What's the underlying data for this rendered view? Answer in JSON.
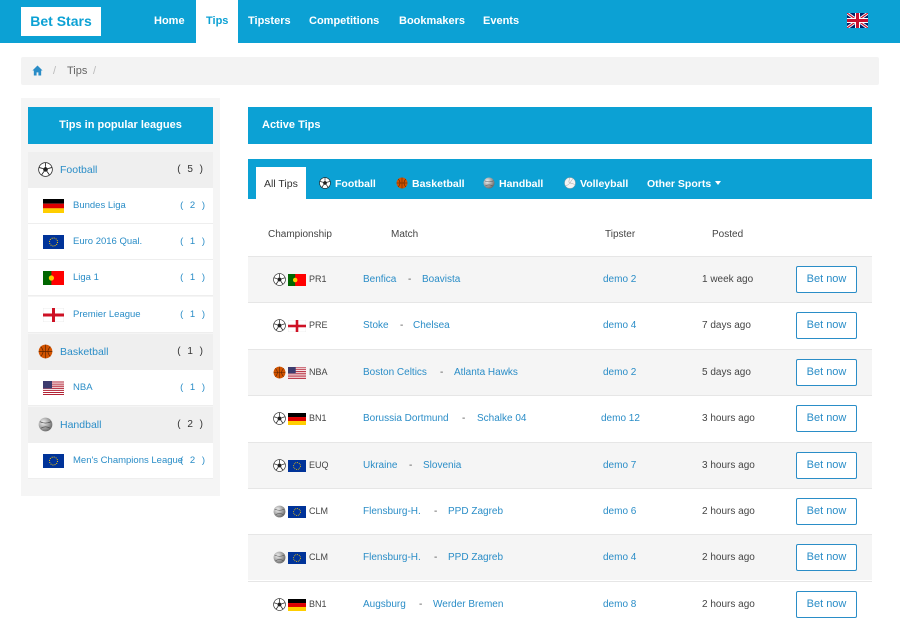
{
  "brand": "Bet Stars",
  "nav": [
    "Home",
    "Tips",
    "Tipsters",
    "Competitions",
    "Bookmakers",
    "Events"
  ],
  "breadcrumb": {
    "current": "Tips"
  },
  "sidebar": {
    "title": "Tips in popular leagues",
    "sports": [
      {
        "label": "Football",
        "count": "( 5 )",
        "icon": "football-icon",
        "leagues": [
          {
            "label": "Bundes Liga",
            "count": "( 2 )",
            "flag": "de"
          },
          {
            "label": "Euro 2016 Qual.",
            "count": "( 1 )",
            "flag": "eu"
          },
          {
            "label": "Liga 1",
            "count": "( 1 )",
            "flag": "pt"
          },
          {
            "label": "Premier League",
            "count": "( 1 )",
            "flag": "en"
          }
        ]
      },
      {
        "label": "Basketball",
        "count": "( 1 )",
        "icon": "basketball-icon",
        "leagues": [
          {
            "label": "NBA",
            "count": "( 1 )",
            "flag": "us"
          }
        ]
      },
      {
        "label": "Handball",
        "count": "( 2 )",
        "icon": "handball-icon",
        "leagues": [
          {
            "label": "Men's Champions League",
            "count": "( 2 )",
            "flag": "eu"
          }
        ]
      }
    ]
  },
  "main": {
    "title": "Active Tips",
    "tabs": [
      {
        "label": "All Tips",
        "icon": ""
      },
      {
        "label": "Football",
        "icon": "football-icon"
      },
      {
        "label": "Basketball",
        "icon": "basketball-icon"
      },
      {
        "label": "Handball",
        "icon": "handball-icon"
      },
      {
        "label": "Volleyball",
        "icon": "volleyball-icon"
      },
      {
        "label": "Other Sports",
        "icon": ""
      }
    ],
    "columns": [
      "Championship",
      "Match",
      "Tipster",
      "Posted"
    ],
    "bet_label": "Bet now",
    "rows": [
      {
        "sport": "football",
        "flag": "pt",
        "code": "PR1",
        "home": "Benfica",
        "away": "Boavista",
        "tipster": "demo 2",
        "posted": "1 week ago"
      },
      {
        "sport": "football",
        "flag": "en",
        "code": "PRE",
        "home": "Stoke",
        "away": "Chelsea",
        "tipster": "demo 4",
        "posted": "7 days ago"
      },
      {
        "sport": "basketball",
        "flag": "us",
        "code": "NBA",
        "home": "Boston Celtics",
        "away": "Atlanta Hawks",
        "tipster": "demo 2",
        "posted": "5 days ago"
      },
      {
        "sport": "football",
        "flag": "de",
        "code": "BN1",
        "home": "Borussia Dortmund",
        "away": "Schalke 04",
        "tipster": "demo 12",
        "posted": "3 hours ago"
      },
      {
        "sport": "football",
        "flag": "eu",
        "code": "EUQ",
        "home": "Ukraine",
        "away": "Slovenia",
        "tipster": "demo 7",
        "posted": "3 hours ago"
      },
      {
        "sport": "handball",
        "flag": "eu",
        "code": "CLM",
        "home": "Flensburg-H.",
        "away": "PPD Zagreb",
        "tipster": "demo 6",
        "posted": "2 hours ago"
      },
      {
        "sport": "handball",
        "flag": "eu",
        "code": "CLM",
        "home": "Flensburg-H.",
        "away": "PPD Zagreb",
        "tipster": "demo 4",
        "posted": "2 hours ago"
      },
      {
        "sport": "football",
        "flag": "de",
        "code": "BN1",
        "home": "Augsburg",
        "away": "Werder Bremen",
        "tipster": "demo 8",
        "posted": "2 hours ago"
      }
    ]
  },
  "colors": {
    "primary": "#0ca1d4",
    "link": "#2a8dc7"
  }
}
